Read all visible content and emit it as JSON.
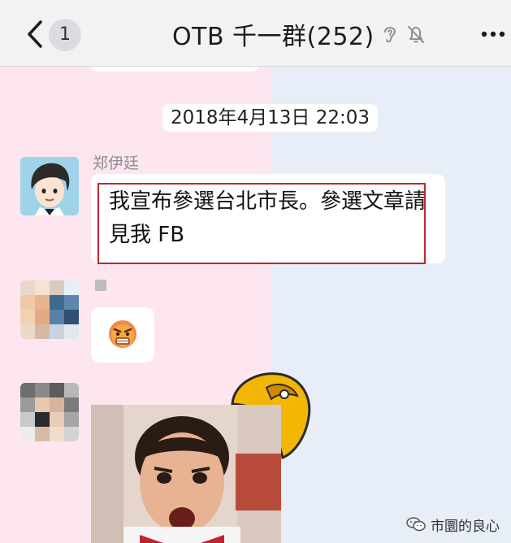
{
  "nav": {
    "badge_count": "1",
    "title": "OTB 千一群(252)",
    "icons": [
      "chevron-left-icon",
      "ear-icon",
      "bell-mute-icon",
      "more-icon"
    ]
  },
  "chat": {
    "timestamp": "2018年4月13日 22:03",
    "messages": [
      {
        "sender": "郑伊廷",
        "text": "我宣布參選台北市長。參選文章請見我 FB"
      },
      {
        "sender": "",
        "content": "angry-face-emoji"
      },
      {
        "sender": "",
        "content": "photo"
      }
    ]
  },
  "watermark": {
    "text": "市圜的良心"
  },
  "colors": {
    "left_bg": "#fde6ef",
    "right_bg": "#e8eef8",
    "highlight": "#c8242f",
    "nav_bg": "#f2f2f4"
  }
}
